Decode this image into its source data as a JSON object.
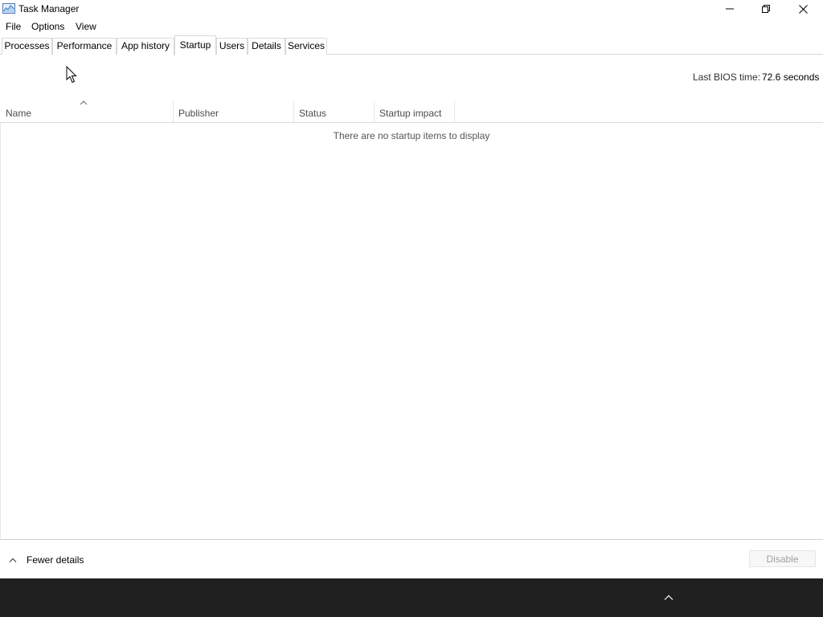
{
  "window": {
    "title": "Task Manager",
    "icon": "task-manager-icon"
  },
  "titlebar_buttons": [
    "minimize-icon",
    "restore-icon",
    "close-icon"
  ],
  "menu": {
    "items": [
      {
        "label": "File"
      },
      {
        "label": "Options"
      },
      {
        "label": "View"
      }
    ]
  },
  "tabs": [
    {
      "label": "Processes",
      "active": false
    },
    {
      "label": "Performance",
      "active": false
    },
    {
      "label": "App history",
      "active": false
    },
    {
      "label": "Startup",
      "active": true
    },
    {
      "label": "Users",
      "active": false
    },
    {
      "label": "Details",
      "active": false
    },
    {
      "label": "Services",
      "active": false
    }
  ],
  "startup": {
    "bios_label": "Last BIOS time:",
    "bios_value": "72.6 seconds",
    "columns": [
      {
        "label": "Name",
        "sorted": "ascending"
      },
      {
        "label": "Publisher"
      },
      {
        "label": "Status"
      },
      {
        "label": "Startup impact"
      }
    ],
    "rows": [],
    "empty_message": "There are no startup items to display"
  },
  "footer": {
    "fewer_details": "Fewer details",
    "disable_button": "Disable",
    "disable_enabled": false
  },
  "taskbar": {
    "background": "#202020",
    "tray_icon": "chevron-up-icon"
  }
}
